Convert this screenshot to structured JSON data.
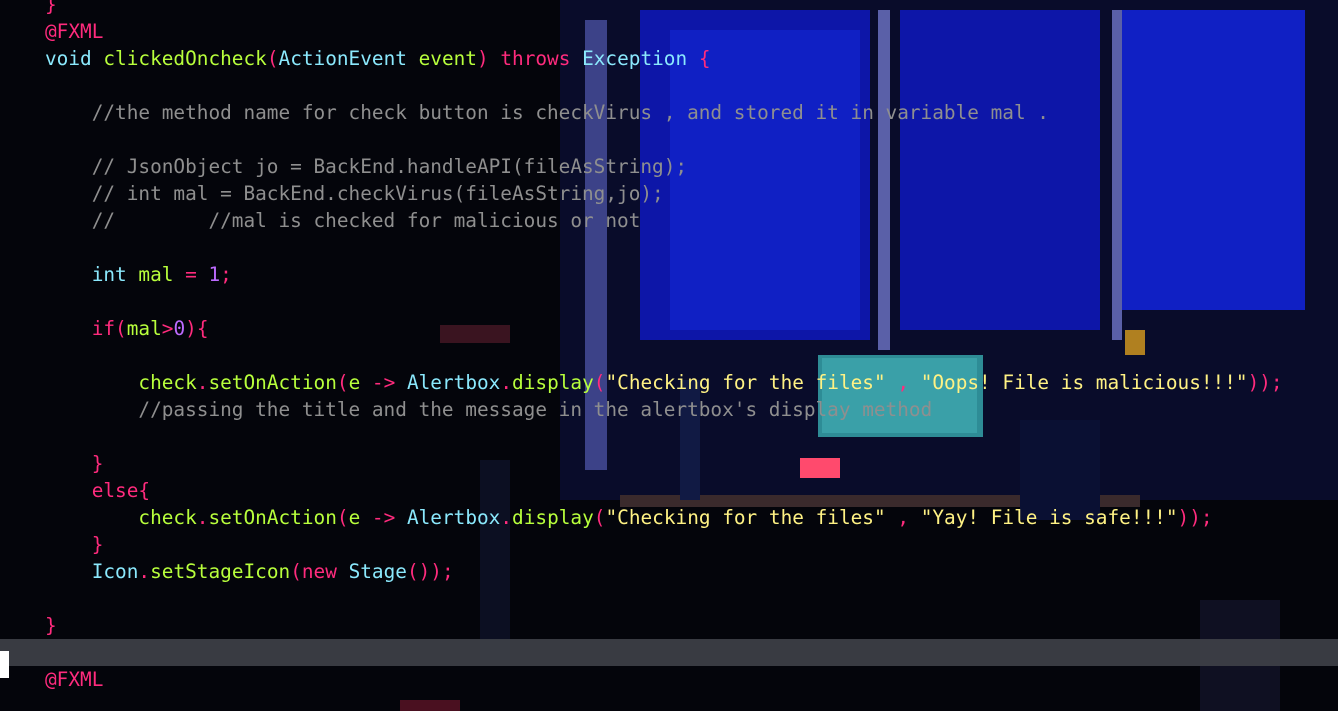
{
  "editor": {
    "lines": [
      [
        {
          "t": "}",
          "c": "kw"
        }
      ],
      [
        {
          "t": "@FXML",
          "c": "ann"
        }
      ],
      [
        {
          "t": "void ",
          "c": "type"
        },
        {
          "t": "clickedOncheck",
          "c": "fn"
        },
        {
          "t": "(",
          "c": "kw"
        },
        {
          "t": "ActionEvent ",
          "c": "type"
        },
        {
          "t": "event",
          "c": "fn"
        },
        {
          "t": ") ",
          "c": "kw"
        },
        {
          "t": "throws ",
          "c": "kw"
        },
        {
          "t": "Exception ",
          "c": "type"
        },
        {
          "t": "{",
          "c": "kw"
        }
      ],
      [],
      [
        {
          "t": "    //the method name for check button is checkVirus , and stored it in variable mal .",
          "c": "cm"
        }
      ],
      [],
      [
        {
          "t": "    // JsonObject jo = BackEnd.handleAPI(fileAsString);",
          "c": "cm"
        }
      ],
      [
        {
          "t": "    // int mal = BackEnd.checkVirus(fileAsString,jo);",
          "c": "cm"
        }
      ],
      [
        {
          "t": "    //        //mal is checked for malicious or not",
          "c": "cm"
        }
      ],
      [],
      [
        {
          "t": "    int ",
          "c": "type"
        },
        {
          "t": "mal ",
          "c": "fn"
        },
        {
          "t": "= ",
          "c": "kw"
        },
        {
          "t": "1",
          "c": "num"
        },
        {
          "t": ";",
          "c": "kw"
        }
      ],
      [],
      [
        {
          "t": "    if(",
          "c": "kw"
        },
        {
          "t": "mal",
          "c": "fn"
        },
        {
          "t": ">",
          "c": "kw"
        },
        {
          "t": "0",
          "c": "num"
        },
        {
          "t": "){",
          "c": "kw"
        }
      ],
      [],
      [
        {
          "t": "        check",
          "c": "fn"
        },
        {
          "t": ".",
          "c": "kw"
        },
        {
          "t": "setOnAction",
          "c": "fn"
        },
        {
          "t": "(",
          "c": "kw"
        },
        {
          "t": "e ",
          "c": "fn"
        },
        {
          "t": "-> ",
          "c": "kw"
        },
        {
          "t": "Alertbox",
          "c": "type"
        },
        {
          "t": ".",
          "c": "kw"
        },
        {
          "t": "display",
          "c": "fn"
        },
        {
          "t": "(",
          "c": "kw"
        },
        {
          "t": "\"Checking for the files\"",
          "c": "str"
        },
        {
          "t": " , ",
          "c": "kw"
        },
        {
          "t": "\"Oops! File is malicious!!!\"",
          "c": "str"
        },
        {
          "t": "));",
          "c": "kw"
        }
      ],
      [
        {
          "t": "        //passing the title and the message in the alertbox's display method",
          "c": "cm"
        }
      ],
      [],
      [
        {
          "t": "    }",
          "c": "kw"
        }
      ],
      [
        {
          "t": "    else{",
          "c": "kw"
        }
      ],
      [
        {
          "t": "        check",
          "c": "fn"
        },
        {
          "t": ".",
          "c": "kw"
        },
        {
          "t": "setOnAction",
          "c": "fn"
        },
        {
          "t": "(",
          "c": "kw"
        },
        {
          "t": "e ",
          "c": "fn"
        },
        {
          "t": "-> ",
          "c": "kw"
        },
        {
          "t": "Alertbox",
          "c": "type"
        },
        {
          "t": ".",
          "c": "kw"
        },
        {
          "t": "display",
          "c": "fn"
        },
        {
          "t": "(",
          "c": "kw"
        },
        {
          "t": "\"Checking for the files\"",
          "c": "str"
        },
        {
          "t": " , ",
          "c": "kw"
        },
        {
          "t": "\"Yay! File is safe!!!\"",
          "c": "str"
        },
        {
          "t": "));",
          "c": "kw"
        }
      ],
      [
        {
          "t": "    }",
          "c": "kw"
        }
      ],
      [
        {
          "t": "    Icon",
          "c": "type"
        },
        {
          "t": ".",
          "c": "kw"
        },
        {
          "t": "setStageIcon",
          "c": "fn"
        },
        {
          "t": "(",
          "c": "kw"
        },
        {
          "t": "new ",
          "c": "kw"
        },
        {
          "t": "Stage",
          "c": "type"
        },
        {
          "t": "());",
          "c": "kw"
        }
      ],
      [],
      [
        {
          "t": "}",
          "c": "kw"
        }
      ],
      [],
      [
        {
          "t": "@FXML",
          "c": "ann"
        }
      ]
    ],
    "current_line_index": 24,
    "colors": {
      "background": "#04050b",
      "keyword": "#ff2b7d",
      "type": "#8be9fd",
      "function": "#b8ff3c",
      "string": "#fff284",
      "number": "#bd6bff",
      "comment": "#8f8f8f",
      "current_line": "#3e4048"
    }
  }
}
